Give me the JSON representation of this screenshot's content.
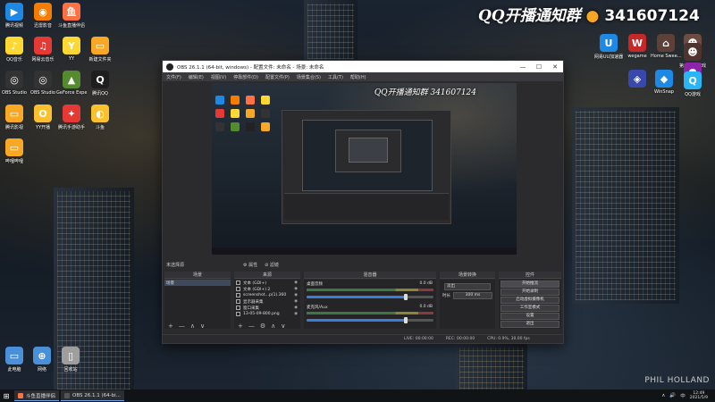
{
  "desktop": {
    "banner_text": "QQ开播通知群",
    "banner_number": "341607124",
    "watermark": "PHIL HOLLAND",
    "left_icons": [
      {
        "label": "腾讯视频",
        "color": "#1e88e5",
        "glyph": "▶"
      },
      {
        "label": "迅雷影音",
        "color": "#f57c00",
        "glyph": "◉"
      },
      {
        "label": "斗鱼直播伴侣",
        "color": "#ff7043",
        "glyph": "鱼"
      },
      {
        "label": "QQ音乐",
        "color": "#fdd835",
        "glyph": "♪"
      },
      {
        "label": "网易云音乐",
        "color": "#e53935",
        "glyph": "♫"
      },
      {
        "label": "YY",
        "color": "#fdd835",
        "glyph": "Y"
      },
      {
        "label": "新建文件夹",
        "color": "#f9a825",
        "glyph": "▭"
      },
      {
        "label": "OBS Studio",
        "color": "#333",
        "glyph": "◎"
      },
      {
        "label": "OBS Studio",
        "color": "#333",
        "glyph": "◎"
      },
      {
        "label": "GeForce Experience",
        "color": "#558b2f",
        "glyph": "▲"
      },
      {
        "label": "腾讯QQ",
        "color": "#1e1e1e",
        "glyph": "Q"
      },
      {
        "label": "腾讯影视",
        "color": "#f9a825",
        "glyph": "▭"
      },
      {
        "label": "YY开播",
        "color": "#fbc02d",
        "glyph": "O"
      },
      {
        "label": "腾讯手游助手",
        "color": "#e53935",
        "glyph": "✦"
      },
      {
        "label": "斗鱼",
        "color": "#fbc02d",
        "glyph": "◐"
      },
      {
        "label": "哔哩哔哩",
        "color": "#f9a825",
        "glyph": "▭"
      }
    ],
    "bottom_icons": [
      {
        "label": "此电脑",
        "color": "#4a90d9",
        "glyph": "▭"
      },
      {
        "label": "网络",
        "color": "#4a90d9",
        "glyph": "⊕"
      },
      {
        "label": "回收站",
        "color": "#9e9e9e",
        "glyph": "▯"
      }
    ],
    "right_icons": [
      {
        "label": "网易UU加速器",
        "color": "#1e88e5",
        "glyph": "U"
      },
      {
        "label": "wegame",
        "color": "#c62828",
        "glyph": "W"
      },
      {
        "label": "Home Swee...",
        "color": "#5d4037",
        "glyph": "⌂"
      },
      {
        "label": "第五人格",
        "color": "#6d4c41",
        "glyph": "☻"
      },
      {
        "label": "第五人格游戏",
        "color": "#4e342e",
        "glyph": "☻"
      },
      {
        "label": "",
        "color": "#3949ab",
        "glyph": "◈"
      },
      {
        "label": "WinSnap",
        "color": "#1e88e5",
        "glyph": "◆"
      },
      {
        "label": "",
        "color": "#8e24aa",
        "glyph": "●"
      },
      {
        "label": "QQ游戏",
        "color": "#29b6f6",
        "glyph": "Q"
      }
    ]
  },
  "obs": {
    "title": "OBS 26.1.1 (64-bit, windows) - 配置文件: 未命名 - 场景: 未命名",
    "window_controls": [
      "—",
      "☐",
      "✕"
    ],
    "menu": [
      "文件(F)",
      "编辑(E)",
      "视图(V)",
      "停靠部件(D)",
      "配置文件(P)",
      "场景集合(S)",
      "工具(T)",
      "帮助(H)"
    ],
    "preview_banner": "QQ开播通知群  341607124",
    "dock_title": "未选择源",
    "dock_buttons": [
      "⚙ 属性",
      "⊘ 滤镜"
    ],
    "scenes": {
      "header": "场景",
      "items": [
        "场景"
      ],
      "footer": [
        "+",
        "—",
        "∧",
        "∨"
      ]
    },
    "sources": {
      "header": "来源",
      "items": [
        "文本 (GDI+)",
        "文本 (GDI+) 2",
        "screenshot...p(1).360",
        "显示器采集",
        "窗口采集",
        "13-05-09-800.png"
      ],
      "footer": [
        "+",
        "—",
        "⚙",
        "∧",
        "∨"
      ]
    },
    "mixer": {
      "header": "混音器",
      "channels": [
        {
          "name": "桌面音频",
          "db": "0.0 dB",
          "level": 0.78
        },
        {
          "name": "麦克风/Aux",
          "db": "0.0 dB",
          "level": 0.78
        }
      ]
    },
    "transitions": {
      "header": "场景转换",
      "type_value": "淡出",
      "duration_label": "时长",
      "duration_value": "300 ms"
    },
    "controls": {
      "header": "控件",
      "buttons": [
        "开始推流",
        "开始录制",
        "启动虚拟摄像机",
        "工作室模式",
        "设置",
        "退出"
      ]
    },
    "status": {
      "live": "LIVE: 00:00:00",
      "rec": "REC: 00:00:00",
      "cpu": "CPU: 0.9%, 30.00 fps"
    }
  },
  "taskbar": {
    "apps": [
      {
        "label": "斗鱼直播伴侣",
        "color": "#ff7043"
      },
      {
        "label": "OBS 26.1.1 (64-bi...",
        "color": "#555"
      }
    ],
    "tray_icons": [
      "∧",
      "🔊",
      "中"
    ],
    "time": "12:49",
    "date": "2021/5/9"
  }
}
